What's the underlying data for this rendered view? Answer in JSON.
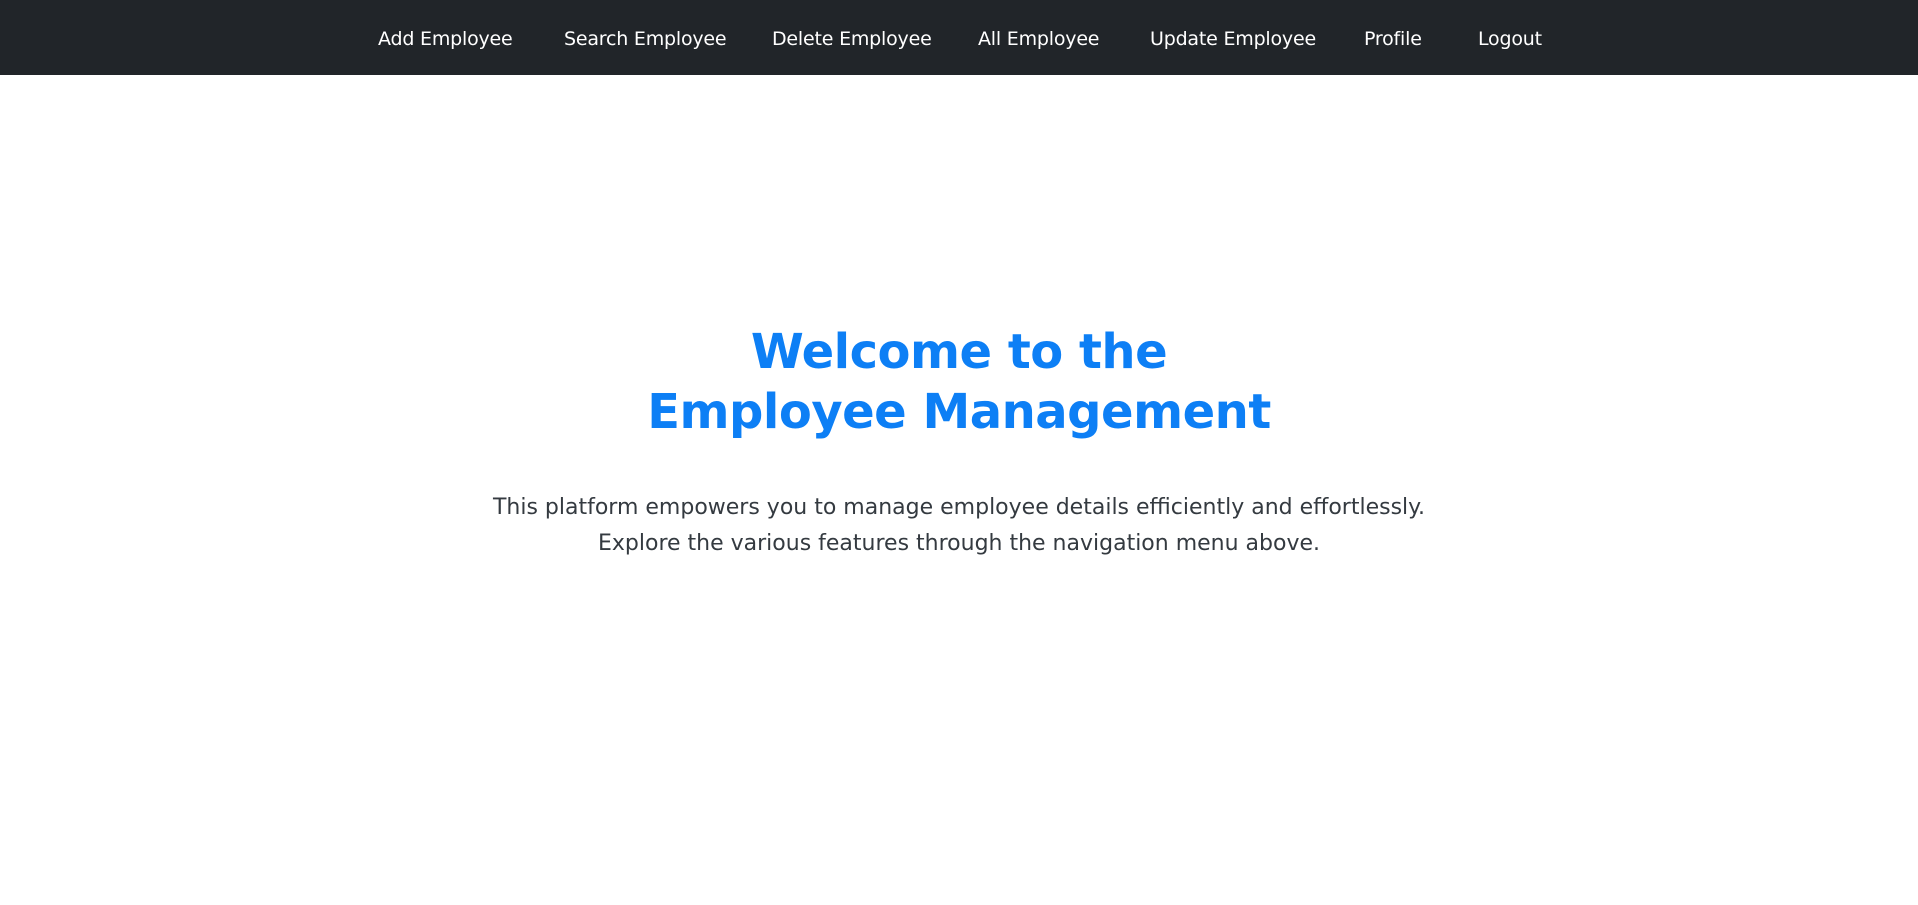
{
  "nav": {
    "items": [
      {
        "label": "Add Employee"
      },
      {
        "label": "Search Employee"
      },
      {
        "label": "Delete Employee"
      },
      {
        "label": "All Employee"
      },
      {
        "label": "Update Employee"
      },
      {
        "label": "Profile"
      },
      {
        "label": "Logout"
      }
    ]
  },
  "hero": {
    "title_line1": "Welcome to the",
    "title_line2": "Employee Management",
    "text_line1": "This platform empowers you to manage employee details efficiently and effortlessly.",
    "text_line2": "Explore the various features through the navigation menu above."
  },
  "colors": {
    "navbar_bg": "#212529",
    "title": "#0d7ff5",
    "body_text": "#343a40"
  }
}
